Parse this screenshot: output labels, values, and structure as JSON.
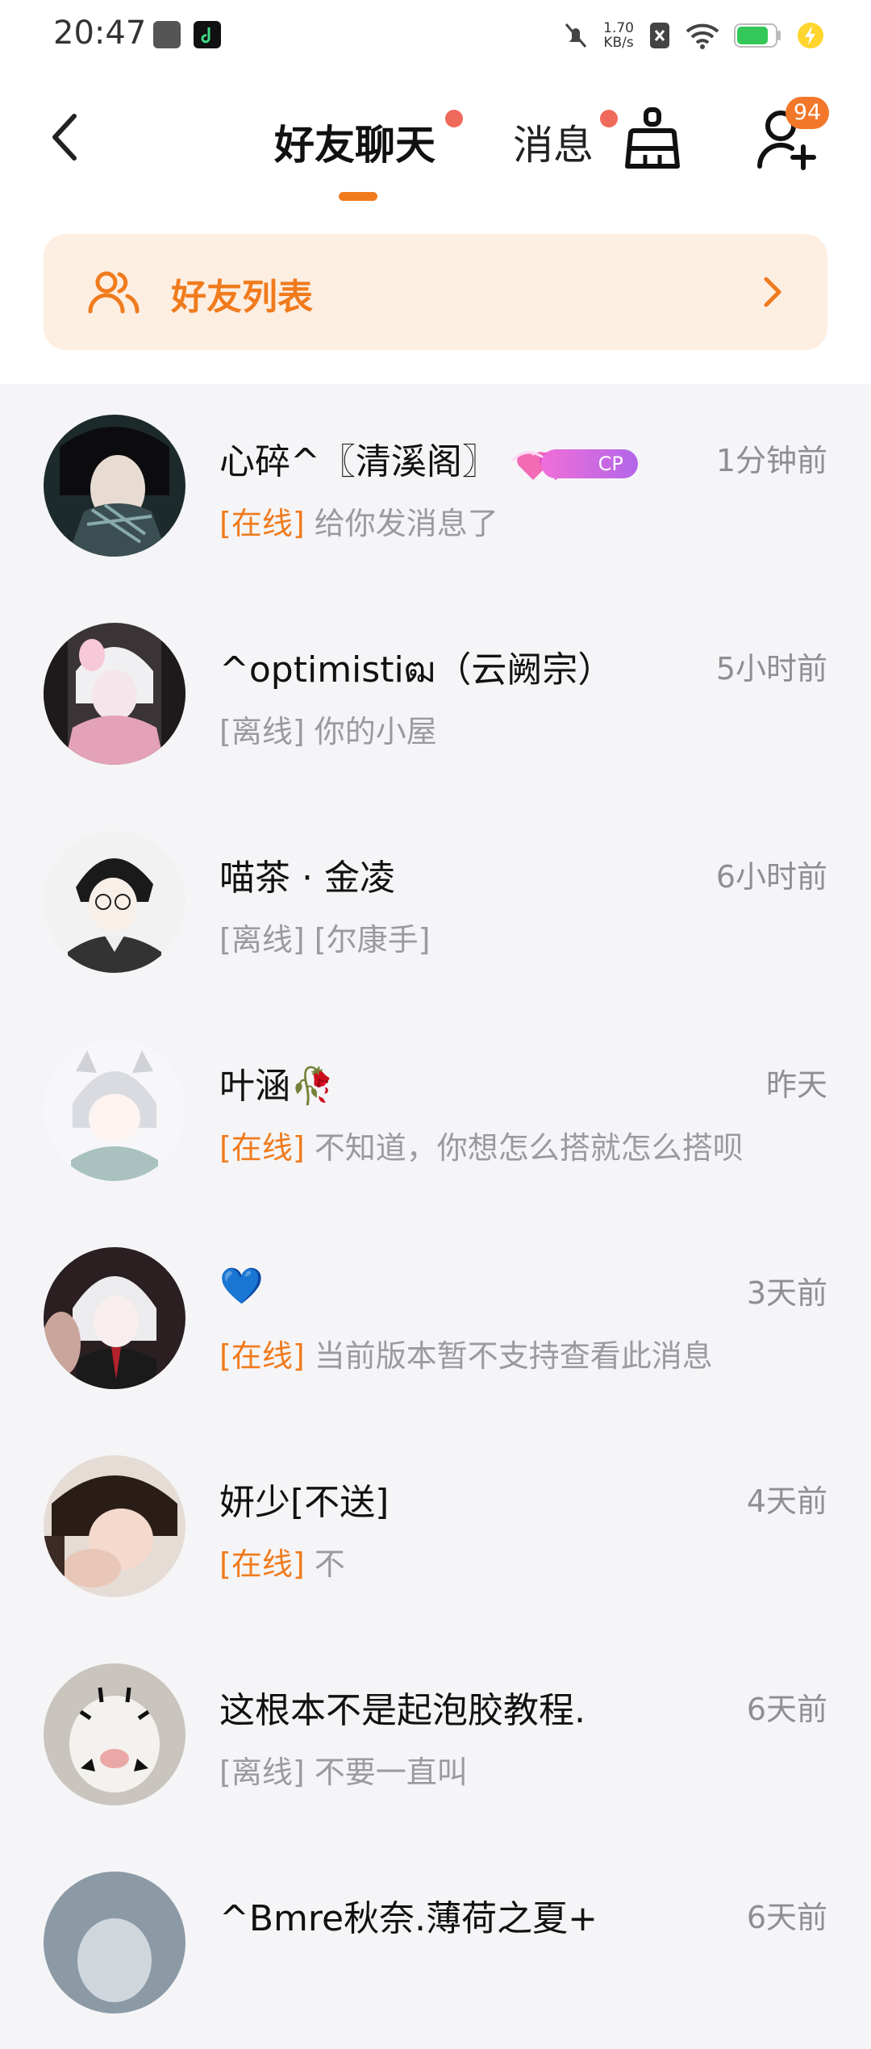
{
  "status_bar": {
    "time": "20:47",
    "net_speed_value": "1.70",
    "net_speed_unit": "KB/s"
  },
  "header": {
    "tabs": [
      {
        "label": "好友聊天",
        "active": true,
        "has_dot": true
      },
      {
        "label": "消息",
        "active": false,
        "has_dot": true
      }
    ],
    "friend_request_count": "94"
  },
  "banner": {
    "label": "好友列表"
  },
  "chats": [
    {
      "name": "心碎^〖清溪阁〗",
      "cp_badge": "CP",
      "status": "[在线]",
      "online": true,
      "preview": "给你发消息了",
      "time": "1分钟前"
    },
    {
      "name": "^optimistiฒ（云阙宗）",
      "status": "[离线]",
      "online": false,
      "preview": "你的小屋",
      "time": "5小时前"
    },
    {
      "name": "喵茶 · 金凌",
      "status": "[离线]",
      "online": false,
      "preview": "[尔康手]",
      "time": "6小时前"
    },
    {
      "name": "叶涵🥀",
      "status": "[在线]",
      "online": true,
      "preview": "不知道，你想怎么搭就怎么搭呗",
      "time": "昨天"
    },
    {
      "name": "💙",
      "status": "[在线]",
      "online": true,
      "preview": "当前版本暂不支持查看此消息",
      "time": "3天前"
    },
    {
      "name": "妍少[不送]",
      "status": "[在线]",
      "online": true,
      "preview": "不",
      "time": "4天前"
    },
    {
      "name": "这根本不是起泡胶教程.",
      "status": "[离线]",
      "online": false,
      "preview": "不要一直叫",
      "time": "6天前"
    },
    {
      "name": "^Bmre秋奈.薄荷之夏+",
      "status": "",
      "online": false,
      "preview": "",
      "time": "6天前"
    }
  ],
  "colors": {
    "accent": "#f07b1d",
    "dot": "#f06a5c",
    "banner_bg": "#fdeee2",
    "list_bg": "#f5f5f7"
  }
}
